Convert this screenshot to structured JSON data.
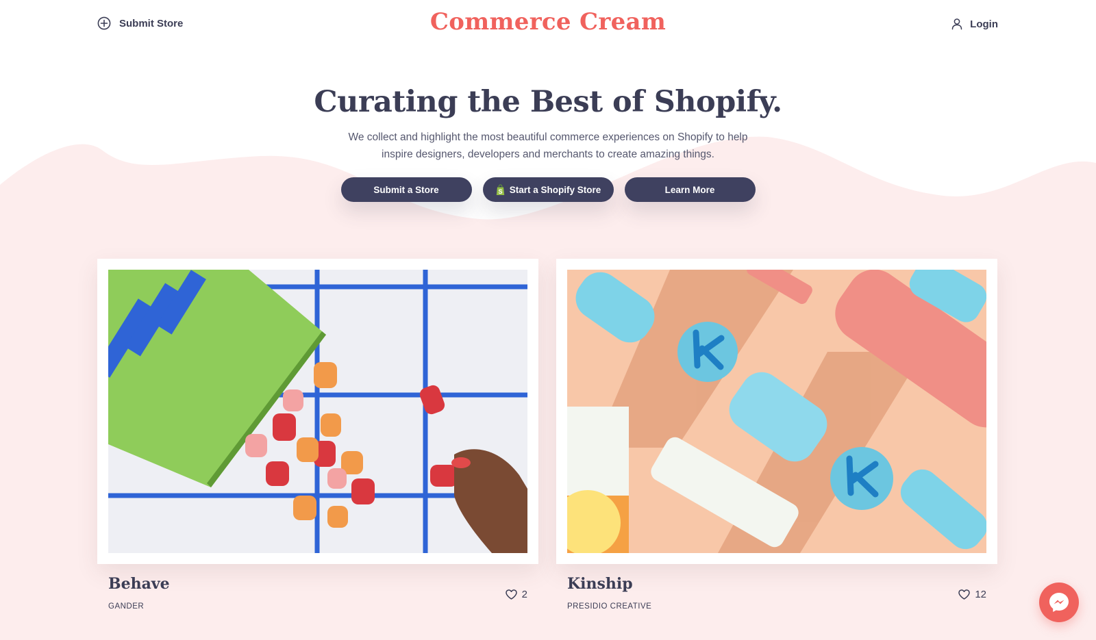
{
  "header": {
    "submit_label": "Submit Store",
    "logo": "Commerce Cream",
    "login_label": "Login"
  },
  "hero": {
    "title": "Curating the Best of Shopify.",
    "subtitle": "We collect and highlight the most beautiful commerce experiences on Shopify to help inspire designers, developers and merchants to create amazing things.",
    "buttons": [
      {
        "label": "Submit a Store",
        "icon": ""
      },
      {
        "label": "Start a Shopify Store",
        "icon": "shopify-bag-icon"
      },
      {
        "label": "Learn More",
        "icon": ""
      }
    ]
  },
  "stores": [
    {
      "name": "Behave",
      "agency": "GANDER",
      "likes": "2"
    },
    {
      "name": "Kinship",
      "agency": "PRESIDIO CREATIVE",
      "likes": "12"
    }
  ],
  "colors": {
    "brand": "#f0625d",
    "ink": "#3b3d55",
    "button": "#3f4160",
    "background": "#fdeded"
  }
}
